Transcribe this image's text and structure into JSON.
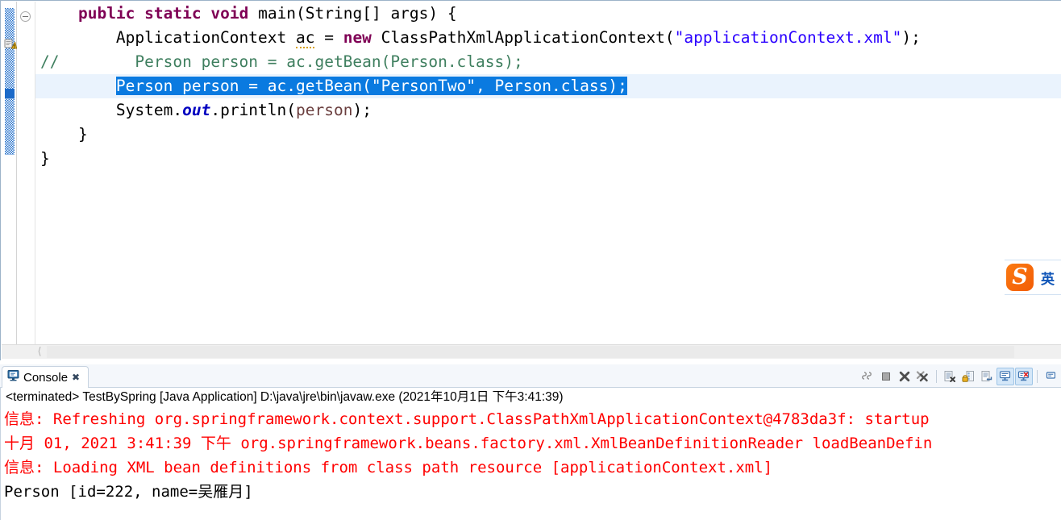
{
  "editor": {
    "lines": [
      {
        "id": "line-main-signature",
        "segments": [
          {
            "text": "    ",
            "style": "plain"
          },
          {
            "text": "public",
            "style": "kw"
          },
          {
            "text": " ",
            "style": "plain"
          },
          {
            "text": "static",
            "style": "kw"
          },
          {
            "text": " ",
            "style": "plain"
          },
          {
            "text": "void",
            "style": "kw"
          },
          {
            "text": " main(String[] args) {",
            "style": "plain"
          }
        ]
      },
      {
        "id": "line-application-context",
        "segments": [
          {
            "text": "        ApplicationContext ",
            "style": "plain"
          },
          {
            "text": "ac",
            "style": "spell"
          },
          {
            "text": " = ",
            "style": "plain"
          },
          {
            "text": "new",
            "style": "kw"
          },
          {
            "text": " ClassPathXmlApplicationContext(",
            "style": "plain"
          },
          {
            "text": "\"applicationContext.xml\"",
            "style": "str"
          },
          {
            "text": ");",
            "style": "plain"
          }
        ]
      },
      {
        "id": "line-commented-getbean",
        "segments": [
          {
            "text": "//        Person person = ac.getBean(Person.class);",
            "style": "cmt"
          }
        ]
      },
      {
        "id": "line-getbean-selected",
        "current": true,
        "segments": [
          {
            "text": "        ",
            "style": "plain"
          },
          {
            "text": "Person person = ac.getBean(\"PersonTwo\", Person.class);",
            "style": "sel"
          }
        ]
      },
      {
        "id": "line-println",
        "segments": [
          {
            "text": "        System.",
            "style": "plain"
          },
          {
            "text": "out",
            "style": "field"
          },
          {
            "text": ".println(",
            "style": "plain"
          },
          {
            "text": "person",
            "style": "param"
          },
          {
            "text": ");",
            "style": "plain"
          }
        ]
      },
      {
        "id": "line-close-method",
        "segments": [
          {
            "text": "    }",
            "style": "plain"
          }
        ]
      },
      {
        "id": "line-close-class",
        "segments": [
          {
            "text": "}",
            "style": "plain"
          }
        ]
      }
    ]
  },
  "ime": {
    "logo_letter": "S",
    "mode_label": "英"
  },
  "console": {
    "tab_label": "Console",
    "tab_close_glyph": "✖",
    "toolbar_buttons": [
      {
        "name": "terminate-all-button",
        "title": "Terminate All"
      },
      {
        "name": "terminate-button",
        "title": "Terminate"
      },
      {
        "name": "remove-launch-button",
        "title": "Remove Launch"
      },
      {
        "name": "remove-all-terminated-button",
        "title": "Remove All Terminated Launches"
      },
      {
        "name": "clear-console-button",
        "title": "Clear Console"
      },
      {
        "name": "scroll-lock-button",
        "title": "Scroll Lock"
      },
      {
        "name": "word-wrap-button",
        "title": "Word Wrap"
      },
      {
        "name": "pin-console-button",
        "title": "Pin Console"
      },
      {
        "name": "display-selected-console-button",
        "title": "Display Selected Console"
      },
      {
        "name": "open-console-button",
        "title": "Open Console"
      }
    ],
    "process_header": "<terminated> TestBySpring [Java Application] D:\\java\\jre\\bin\\javaw.exe (2021年10月1日 下午3:41:39)",
    "output_lines": [
      {
        "id": "console-line-refreshing",
        "color": "red",
        "text": "信息: Refreshing org.springframework.context.support.ClassPathXmlApplicationContext@4783da3f: startup"
      },
      {
        "id": "console-line-timestamp",
        "color": "red",
        "text": "十月 01, 2021 3:41:39 下午 org.springframework.beans.factory.xml.XmlBeanDefinitionReader loadBeanDefin"
      },
      {
        "id": "console-line-loading-xml",
        "color": "red",
        "text": "信息: Loading XML bean definitions from class path resource [applicationContext.xml]"
      },
      {
        "id": "console-line-person-result",
        "color": "black",
        "text": "Person [id=222, name=吴雁月]"
      }
    ]
  },
  "colors": {
    "keyword": "#7F0055",
    "string": "#2A00FF",
    "comment": "#3F7F5F",
    "field": "#0000C0",
    "parameter": "#6A3E3E",
    "selection": "#0A7AE0",
    "console_error": "#FF0000",
    "current_line": "#EAF3FD"
  }
}
